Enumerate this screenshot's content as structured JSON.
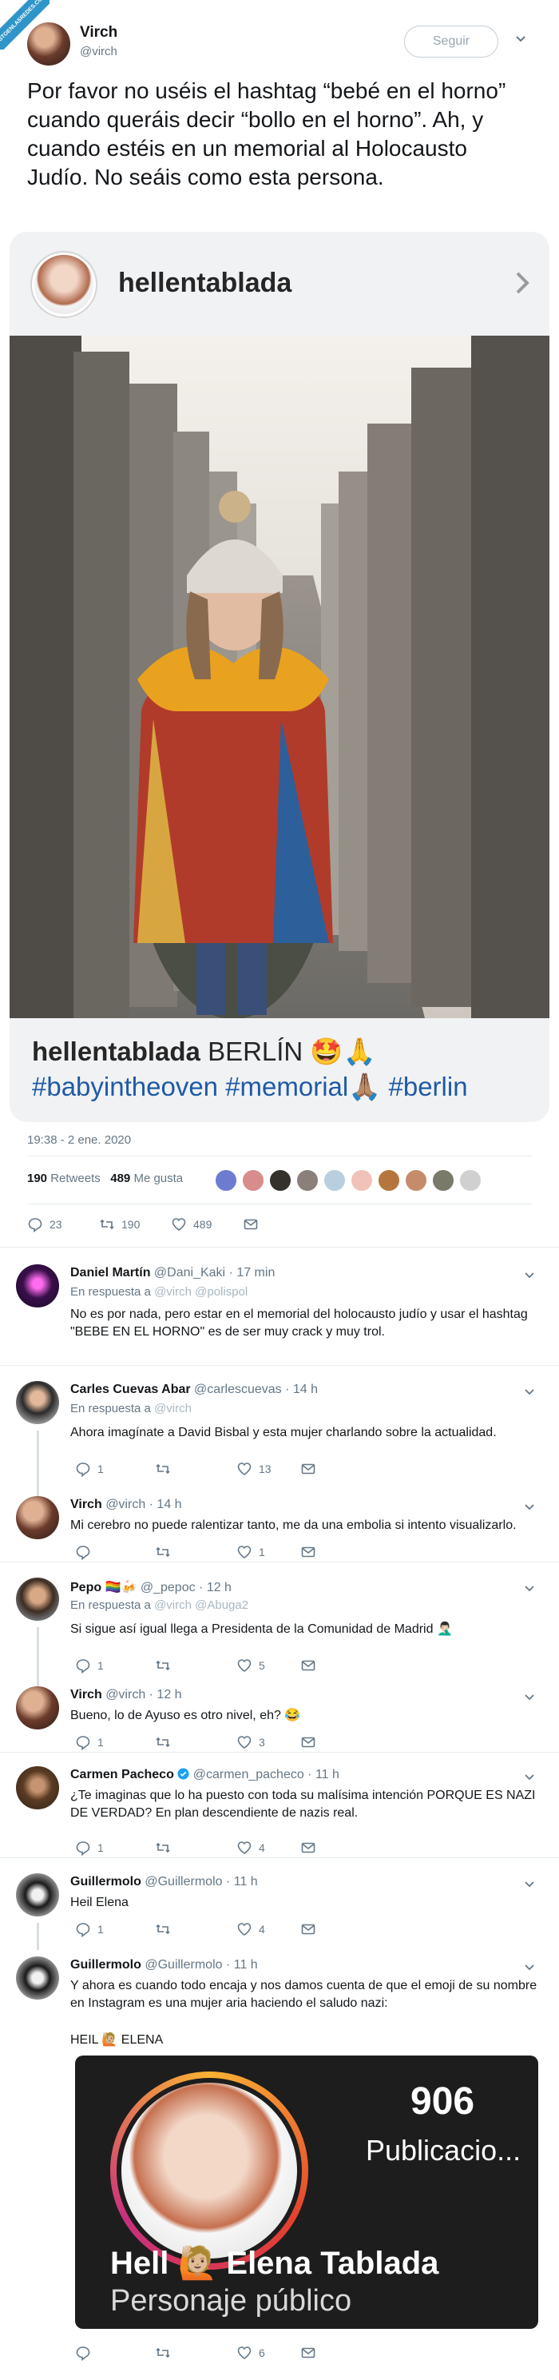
{
  "watermark": "VISTOENLASREDES.COM",
  "tweet": {
    "author_name": "Virch",
    "author_handle": "@virch",
    "follow_label": "Seguir",
    "text": "Por favor no uséis el hashtag “bebé en el horno” cuando queráis decir “bollo en el horno”. Ah, y cuando estéis en un memorial al Holocausto Judío. No seáis como esta persona.",
    "date": "19:38 - 2 ene. 2020",
    "retweets_count": "190",
    "retweets_label": "Retweets",
    "likes_count": "489",
    "likes_label": "Me gusta",
    "actions": {
      "replies": "23",
      "retweets": "190",
      "likes": "489"
    }
  },
  "instagram_post": {
    "username": "hellentablada",
    "caption_text": "BERLÍN 🤩🙏",
    "hashtags": "#babyintheoven #memorial🙏🏽 #berlin"
  },
  "colors": {
    "accent": "#1da1f2",
    "muted": "#657786",
    "border": "#e6ecf0",
    "hashtag": "#1f5aa6",
    "like": "#e0245e"
  },
  "replies": [
    {
      "name": "Daniel Martín",
      "handle": "@Dani_Kaki · 17 min",
      "in_reply_prefix": "En respuesta a",
      "in_reply_to": "@virch @polispol",
      "text": "No es por nada, pero estar en el memorial del holocausto judío y usar el hashtag \"BEBE EN EL HORNO\" es de ser muy crack y muy trol."
    },
    {
      "name": "Carles Cuevas Abar",
      "handle": "@carlescuevas · 14 h",
      "in_reply_prefix": "En respuesta a",
      "in_reply_to": "@virch",
      "text": "Ahora imagínate a David Bisbal y esta mujer charlando sobre la actualidad.",
      "actions": {
        "replies": "1",
        "retweets": "",
        "likes": "13"
      }
    },
    {
      "name": "Virch",
      "handle": "@virch · 14 h",
      "text": "Mi cerebro no puede ralentizar tanto, me da una embolia si intento visualizarlo.",
      "actions": {
        "replies": "",
        "retweets": "",
        "likes": "1"
      }
    },
    {
      "name": "Pepo 🏳️‍🌈🍻",
      "handle": "@_pepoc · 12 h",
      "in_reply_prefix": "En respuesta a",
      "in_reply_to": "@virch @Abuga2",
      "text": "Si sigue así igual llega a Presidenta de la Comunidad de Madrid 🤦🏻‍♂️",
      "actions": {
        "replies": "1",
        "retweets": "",
        "likes": "5"
      }
    },
    {
      "name": "Virch",
      "handle": "@virch · 12 h",
      "text": "Bueno, lo de Ayuso es otro nivel, eh? 😂",
      "actions": {
        "replies": "1",
        "retweets": "",
        "likes": "3"
      }
    },
    {
      "name": "Carmen Pacheco",
      "handle": "@carmen_pacheco · 11 h",
      "text": "¿Te imaginas que lo ha puesto con toda su malísima intención PORQUE ES NAZI DE VERDAD? En plan descendiente de nazis real.",
      "actions": {
        "replies": "1",
        "retweets": "",
        "likes": "4"
      }
    },
    {
      "name": "Guillermolo",
      "handle": "@Guillermolo · 11 h",
      "text": "Heil Elena",
      "actions": {
        "replies": "1",
        "retweets": "",
        "likes": "4"
      }
    },
    {
      "name": "Guillermolo",
      "handle": "@Guillermolo · 11 h",
      "text": "Y ahora es cuando todo encaja y nos damos cuenta de que el emoji de su nombre en Instagram es una mujer aria haciendo el saludo nazi:",
      "text2": "HEIL 🙋🏼 ELENA",
      "actions": {
        "replies": "",
        "retweets": "",
        "likes": "6"
      },
      "embed": {
        "posts_count": "906",
        "posts_label": "Publicacio...",
        "profile_name": "Hell 🙋🏼 Elena Tablada",
        "profile_category": "Personaje público"
      }
    }
  ]
}
